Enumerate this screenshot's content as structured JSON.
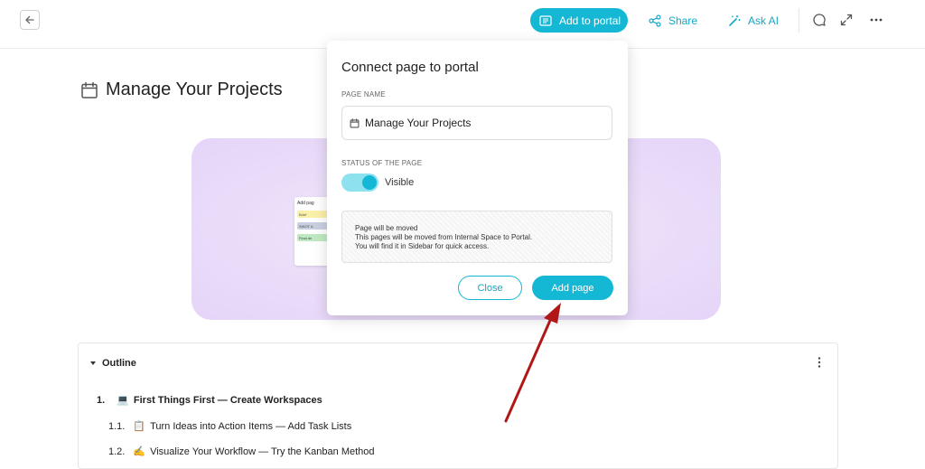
{
  "header": {
    "add_to_portal": "Add to portal",
    "share": "Share",
    "ask_ai": "Ask AI",
    "accent": "#14b8d4"
  },
  "page": {
    "title": "Manage Your Projects"
  },
  "cover_card": {
    "title": "Add pag",
    "chips": [
      "Brief",
      "SWOT A",
      "Final de"
    ]
  },
  "modal": {
    "title": "Connect page to portal",
    "page_name_label": "PAGE NAME",
    "page_name_value": "Manage Your Projects",
    "status_label": "STATUS OF THE PAGE",
    "status_value": "Visible",
    "status_on": true,
    "info_lines": [
      "Page will be moved",
      "This pages will be moved from Internal Space to Portal.",
      "You will find it in Sidebar for quick access."
    ],
    "close_label": "Close",
    "add_page_label": "Add page"
  },
  "outline": {
    "heading": "Outline",
    "items": [
      {
        "number": "1.",
        "emoji": "💻",
        "text": "First Things First — Create Workspaces"
      },
      {
        "number": "1.1.",
        "emoji": "📋",
        "text": "Turn Ideas into Action Items — Add Task Lists"
      },
      {
        "number": "1.2.",
        "emoji": "✍️",
        "text": "Visualize Your Workflow — Try the Kanban Method"
      }
    ]
  }
}
